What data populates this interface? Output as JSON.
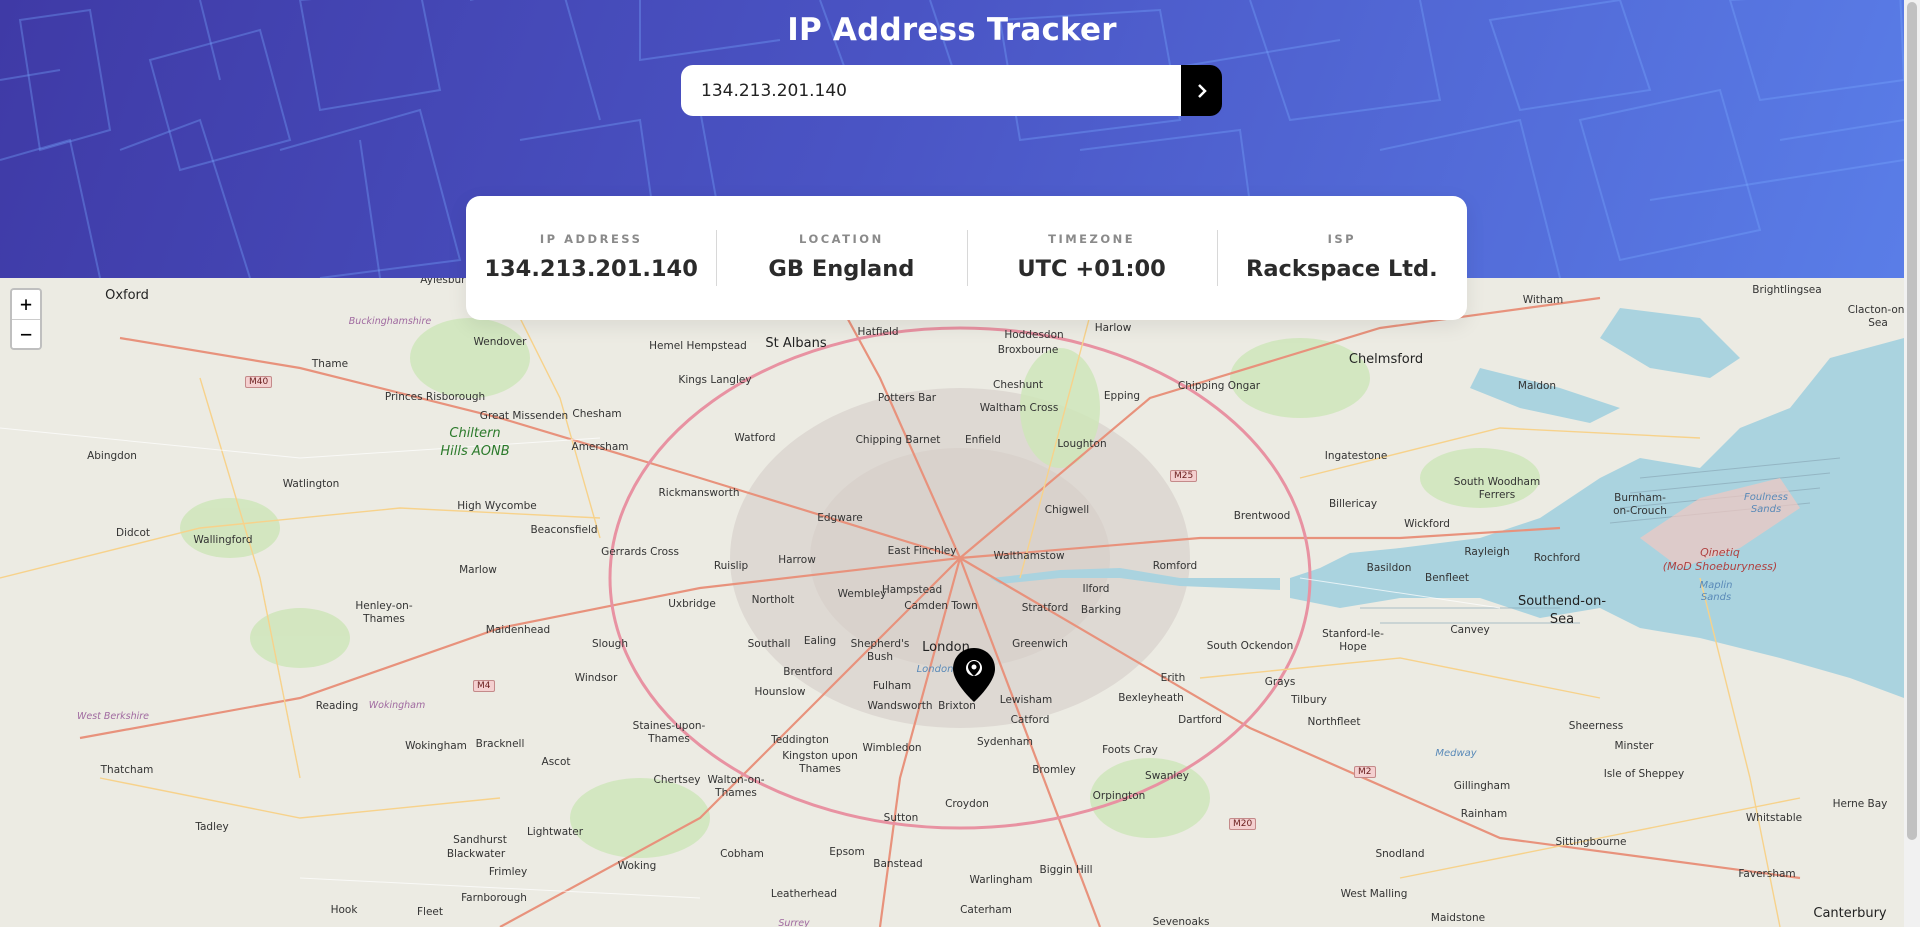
{
  "header": {
    "title": "IP Address Tracker"
  },
  "search": {
    "value": "134.213.201.140",
    "button_icon": "chevron-right-icon"
  },
  "info": {
    "ip": {
      "label": "IP ADDRESS",
      "value": "134.213.201.140"
    },
    "location": {
      "label": "LOCATION",
      "value": "GB England"
    },
    "timezone": {
      "label": "TIMEZONE",
      "value": "UTC +01:00"
    },
    "isp": {
      "label": "ISP",
      "value": "Rackspace Ltd."
    }
  },
  "map": {
    "zoom_in": "+",
    "zoom_out": "−",
    "marker_icon": "location-pin-icon",
    "places": {
      "oxford": "Oxford",
      "aylesbury": "Aylesbury",
      "buckinghamshire": "Buckinghamshire",
      "wendover": "Wendover",
      "thame": "Thame",
      "princes_risborough": "Princes Risborough",
      "great_missenden": "Great Missenden",
      "chesham": "Chesham",
      "amersham": "Amersham",
      "chiltern": "Chiltern",
      "hills_aonb": "Hills AONB",
      "abingdon": "Abingdon",
      "watlington": "Watlington",
      "didcot": "Didcot",
      "wallingford": "Wallingford",
      "high_wycombe": "High Wycombe",
      "beaconsfield": "Beaconsfield",
      "marlow": "Marlow",
      "henley": "Henley-on-",
      "thames_h": "Thames",
      "maidenhead": "Maidenhead",
      "slough": "Slough",
      "windsor": "Windsor",
      "reading": "Reading",
      "wokingham_r": "Wokingham",
      "west_berkshire": "West Berkshire",
      "wokingham": "Wokingham",
      "bracknell": "Bracknell",
      "ascot": "Ascot",
      "thatcham": "Thatcham",
      "tadley": "Tadley",
      "sandhurst": "Sandhurst",
      "blackwater": "Blackwater",
      "lightwater": "Lightwater",
      "frimley": "Frimley",
      "farnborough": "Farnborough",
      "fleet": "Fleet",
      "hook": "Hook",
      "woking": "Woking",
      "hemel": "Hemel Hempstead",
      "st_albans": "St Albans",
      "hatfield": "Hatfield",
      "hoddesdon": "Hoddesdon",
      "harlow": "Harlow",
      "broxbourne": "Broxbourne",
      "kings_langley": "Kings Langley",
      "cheshunt": "Cheshunt",
      "potters_bar": "Potters Bar",
      "waltham_cross": "Waltham Cross",
      "epping": "Epping",
      "chipping_ongar": "Chipping Ongar",
      "chelmsford": "Chelmsford",
      "watford": "Watford",
      "chipping_barnet": "Chipping Barnet",
      "enfield": "Enfield",
      "loughton": "Loughton",
      "rickmansworth": "Rickmansworth",
      "edgware": "Edgware",
      "chigwell": "Chigwell",
      "gerrards_cross": "Gerrards Cross",
      "harrow": "Harrow",
      "east_finchley": "East Finchley",
      "walthamstow": "Walthamstow",
      "ruislip": "Ruislip",
      "romford": "Romford",
      "brentwood": "Brentwood",
      "uxbridge": "Uxbridge",
      "northolt": "Northolt",
      "wembley": "Wembley",
      "hampstead": "Hampstead",
      "camden_town": "Camden Town",
      "stratford": "Stratford",
      "ilford": "Ilford",
      "barking": "Barking",
      "southall": "Southall",
      "ealing": "Ealing",
      "shepherds": "Shepherd's",
      "bush": "Bush",
      "london": "London",
      "london_water": "London",
      "greenwich": "Greenwich",
      "erith": "Erith",
      "south_ockendon": "South Ockendon",
      "grays": "Grays",
      "hounslow": "Hounslow",
      "brentford": "Brentford",
      "fulham": "Fulham",
      "wandsworth": "Wandsworth",
      "brixton": "Brixton",
      "lewisham": "Lewisham",
      "bexleyheath": "Bexleyheath",
      "dartford": "Dartford",
      "tilbury": "Tilbury",
      "northfleet": "Northfleet",
      "catford": "Catford",
      "staines": "Staines-upon-",
      "thames_s": "Thames",
      "teddington": "Teddington",
      "kingston": "Kingston upon",
      "thames_k": "Thames",
      "wimbledon": "Wimbledon",
      "sydenham": "Sydenham",
      "bromley": "Bromley",
      "foots_cray": "Foots Cray",
      "swanley": "Swanley",
      "chertsey": "Chertsey",
      "walton": "Walton-on-",
      "thames_w": "Thames",
      "orpington": "Orpington",
      "sutton": "Sutton",
      "croydon": "Croydon",
      "cobham": "Cobham",
      "epsom": "Epsom",
      "banstead": "Banstead",
      "biggin_hill": "Biggin Hill",
      "warlingham": "Warlingham",
      "leatherhead": "Leatherhead",
      "caterham": "Caterham",
      "sevenoaks": "Sevenoaks",
      "surrey": "Surrey",
      "ingatestone": "Ingatestone",
      "maldon": "Maldon",
      "witham": "Witham",
      "brightlingsea": "Brightlingsea",
      "clacton": "Clacton-on-",
      "sea_c": "Sea",
      "south_woodham": "South Woodham",
      "ferrers": "Ferrers",
      "burnham": "Burnham-",
      "on_crouch": "on-Crouch",
      "billericay": "Billericay",
      "wickford": "Wickford",
      "rayleigh": "Rayleigh",
      "rochford": "Rochford",
      "basildon": "Basildon",
      "benfleet": "Benfleet",
      "southend": "Southend-on-",
      "sea_s": "Sea",
      "canvey": "Canvey",
      "stanford": "Stanford-le-",
      "hope": "Hope",
      "foulness": "Foulness",
      "sands": "Sands",
      "qinetiq": "Qinetiq",
      "mod": "(MoD Shoeburyness)",
      "maplin": "Maplin",
      "sands_m": "Sands",
      "sheerness": "Sheerness",
      "minster": "Minster",
      "isle_sheppey": "Isle of Sheppey",
      "medway": "Medway",
      "gillingham": "Gillingham",
      "rainham": "Rainham",
      "whitstable": "Whitstable",
      "herne_bay": "Herne Bay",
      "sittingbourne": "Sittingbourne",
      "faversham": "Faversham",
      "snodland": "Snodland",
      "west_malling": "West Malling",
      "maidstone": "Maidstone",
      "canterbury": "Canterbury"
    },
    "roads": {
      "m40": "M40",
      "m4": "M4",
      "m25": "M25",
      "m2": "M2",
      "m20": "M20"
    }
  }
}
